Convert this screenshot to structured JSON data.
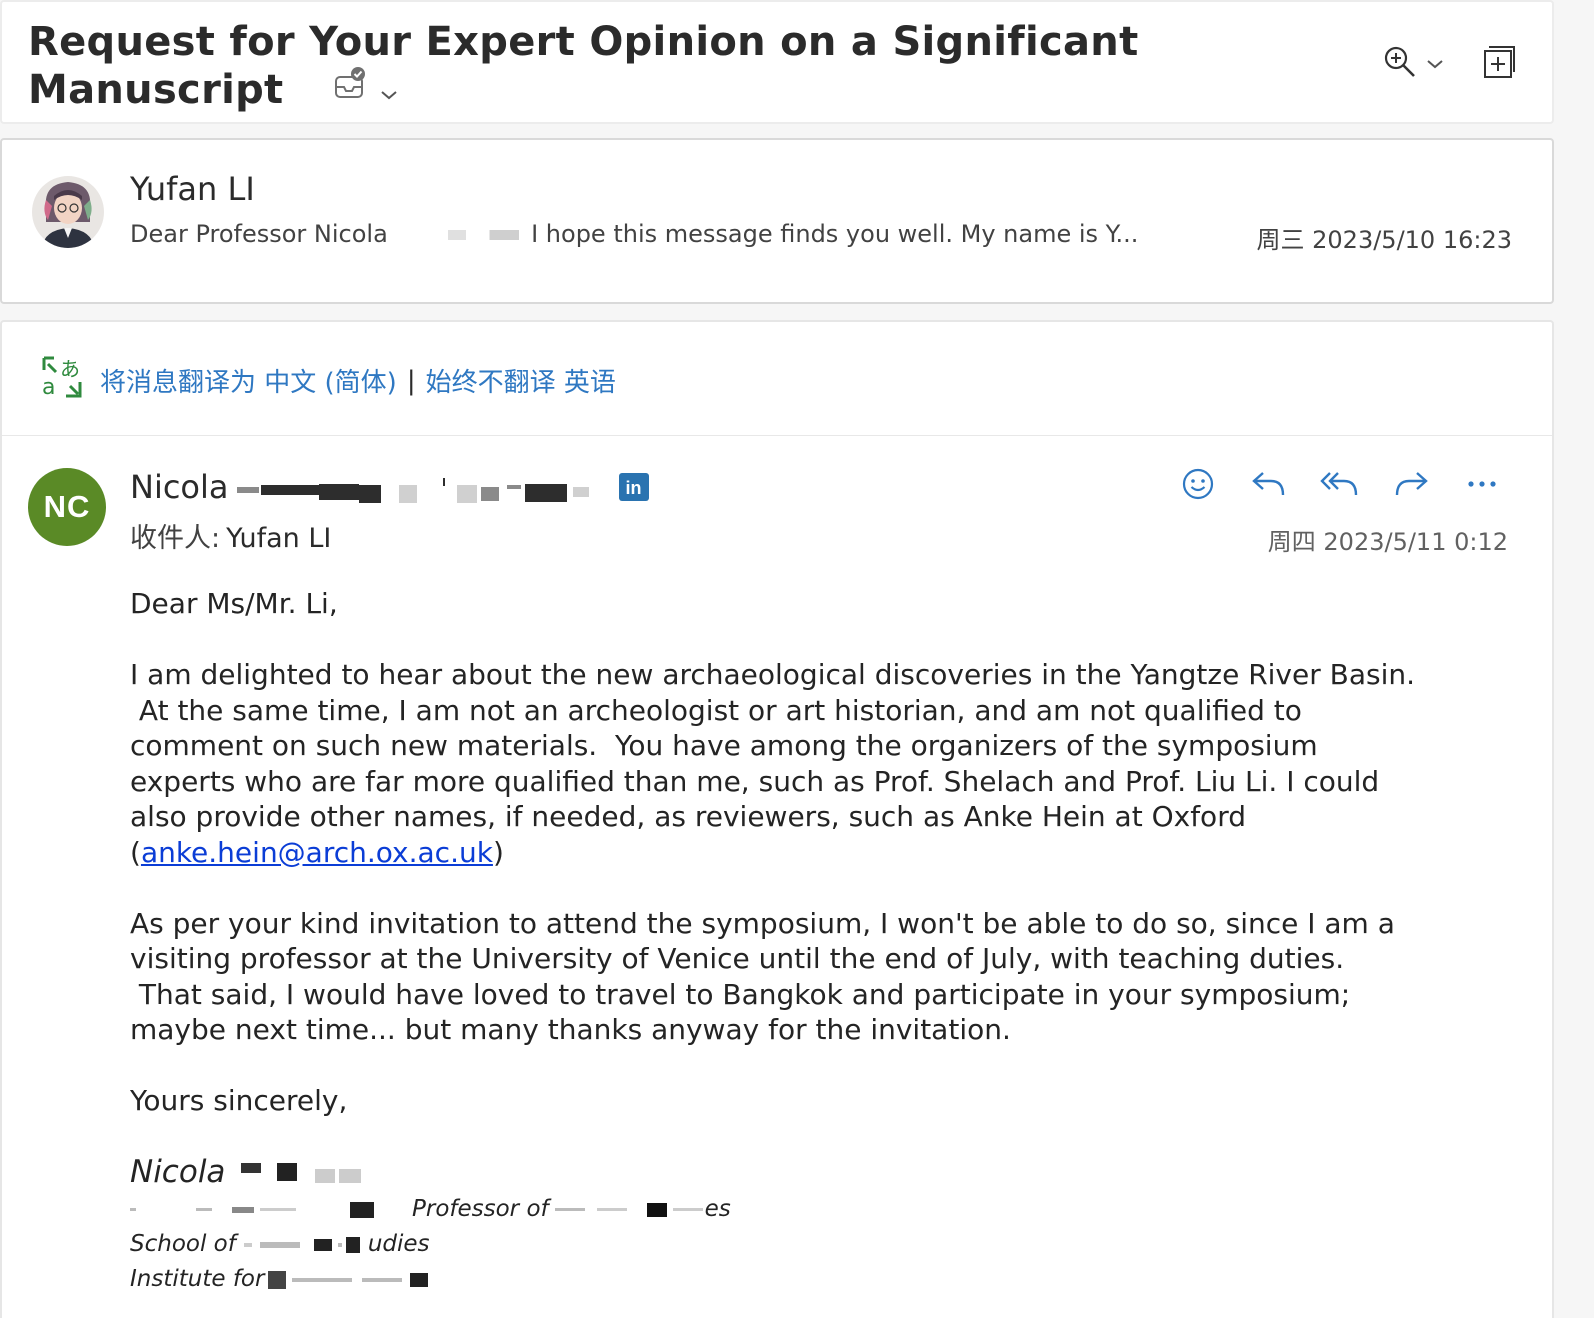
{
  "subject": {
    "line1": "Request for Your Expert Opinion on a Significant",
    "line2": "Manuscript"
  },
  "icons": {
    "tag": "envelope-check-icon",
    "tag_chevron": "chevron-down-icon",
    "zoom": "zoom-in-icon",
    "zoom_chevron": "chevron-down-icon",
    "popout": "open-in-new-window-icon",
    "translate": "translate-icon",
    "emoji": "smile-icon",
    "reply": "reply-icon",
    "reply_all": "reply-all-icon",
    "forward": "forward-icon",
    "more": "more-icon"
  },
  "message1": {
    "sender": "Yufan LI",
    "preview_start": "Dear Professor Nicola",
    "preview_end": "I hope this message finds you well. My name is Y...",
    "date": "周三 2023/5/10 16:23"
  },
  "translate_bar": {
    "translate_text": "将消息翻译为 中文 (简体)",
    "separator": "|",
    "never_text": "始终不翻译 英语"
  },
  "message2": {
    "avatar_initials": "NC",
    "sender_first": "Nicola",
    "linkedin_label": "in",
    "to_label": "收件人:",
    "to_name": "Yufan LI",
    "date": "周四 2023/5/11 0:12",
    "greeting": "Dear Ms/Mr. Li,",
    "para1": "I am delighted to hear about the new archaeological discoveries in the Yangtze River Basin.\n At the same time, I am not an archeologist or art historian, and am not qualified to\ncomment on such new materials.  You have among the organizers of the symposium\nexperts who are far more qualified than me, such as Prof. Shelach and Prof. Liu Li. I could\nalso provide other names, if needed, as reviewers, such as Anke Hein at Oxford\n(",
    "para1_email": "anke.hein@arch.ox.ac.uk",
    "para1_close": ")",
    "para2": "As per your kind invitation to attend the symposium, I won't be able to do so, since I am a\nvisiting professor at the University of Venice until the end of July, with teaching duties.\n That said, I would have loved to travel to Bangkok and participate in your symposium;\nmaybe next time... but many thanks anyway for the invitation.",
    "closing": "Yours sincerely,",
    "sig_name": "Nicola",
    "sig_line1_a": "Professor of",
    "sig_line1_b": "es",
    "sig_line2_a": "School of",
    "sig_line2_b": "udies",
    "sig_line3_a": "Institute for"
  },
  "colors": {
    "link": "#2f78c2",
    "avatar_nc": "#5a8a26",
    "linkedin": "#2a73b0",
    "email_link": "#0b3dd6"
  }
}
